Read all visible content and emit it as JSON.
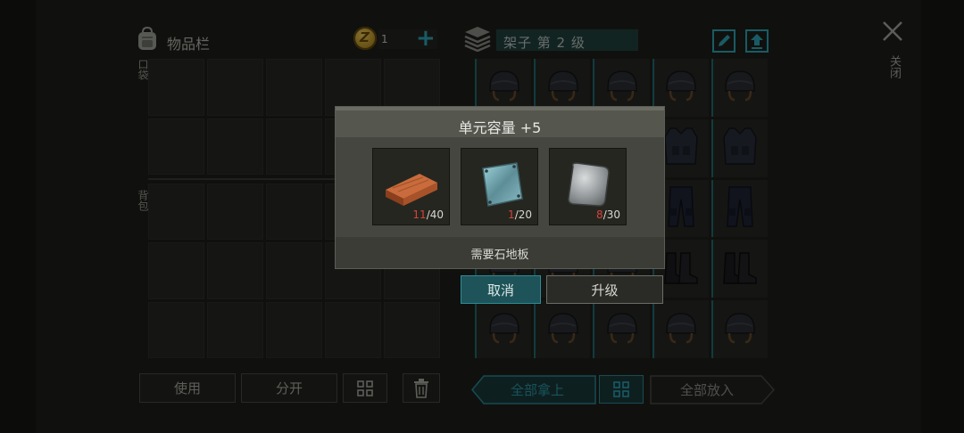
{
  "inventory": {
    "title": "物品栏",
    "pocket_label": "口袋",
    "backpack_label": "背包",
    "currency": {
      "symbol": "Z",
      "count": "1"
    },
    "add_icon": "plus-icon",
    "buttons": {
      "use": "使用",
      "split": "分开"
    }
  },
  "storage": {
    "title": "架子 第 2 级",
    "edit_icon": "edit-icon",
    "upgrade_icon": "upload-icon",
    "close_label": "关闭",
    "buttons": {
      "take_all": "全部拿上",
      "put_all": "全部放入"
    },
    "items": [
      "helmet",
      "helmet",
      "helmet",
      "helmet",
      "helmet",
      "helmet",
      "helmet",
      "helmet",
      "armor-vest",
      "armor-vest",
      "helmet",
      "helmet",
      "helmet",
      "tactical-pants",
      "tactical-pants",
      "helmet",
      "helmet",
      "helmet",
      "combat-boots",
      "combat-boots",
      "helmet",
      "helmet",
      "helmet",
      "helmet",
      "helmet"
    ]
  },
  "dialog": {
    "title": "单元容量 +5",
    "requirement": "需要石地板",
    "materials": [
      {
        "name": "wood-plank",
        "have": "11",
        "need": "/40"
      },
      {
        "name": "glass-pane",
        "have": "1",
        "need": "/20"
      },
      {
        "name": "metal-plate",
        "have": "8",
        "need": "/30"
      }
    ],
    "buttons": {
      "cancel": "取消",
      "upgrade": "升级"
    }
  },
  "colors": {
    "accent": "#2fa6b8",
    "missing": "#d2453d",
    "panel": "#45463f"
  }
}
